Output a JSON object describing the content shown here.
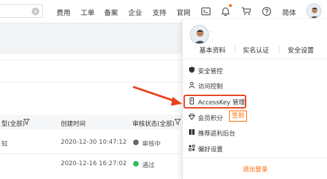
{
  "topbar": {
    "nav": [
      "费用",
      "工单",
      "备案",
      "企业",
      "支持",
      "官网"
    ],
    "lang": "简体",
    "clear_glyph": "×"
  },
  "table": {
    "headers": [
      "型(全部)",
      "创建时间",
      "审核状态(全部)"
    ],
    "rows": [
      {
        "type": "知",
        "created": "2020-12-30 10:47:12",
        "status": "审核中",
        "status_color": "#666666"
      },
      {
        "type": "",
        "created": "2020-12-16 16:27:02",
        "status": "通过",
        "status_color": "#2bbf5b"
      }
    ]
  },
  "account_menu": {
    "username": "·",
    "tabs": [
      "基本资料",
      "实名认证",
      "安全设置"
    ],
    "items": [
      {
        "label": "安全管控",
        "icon": "shield-icon"
      },
      {
        "label": "访问控制",
        "icon": "access-icon"
      },
      {
        "label": "AccessKey 管理",
        "icon": "key-icon"
      },
      {
        "label": "会员积分",
        "icon": "diamond-icon"
      },
      {
        "label": "推荐返利后台",
        "icon": "gift-icon"
      },
      {
        "label": "偏好设置",
        "icon": "settings-icon"
      }
    ],
    "checkin_label": "签到",
    "logout_label": "退出登录"
  },
  "colors": {
    "accent": "#ff6a00",
    "highlight": "#e8431a"
  }
}
